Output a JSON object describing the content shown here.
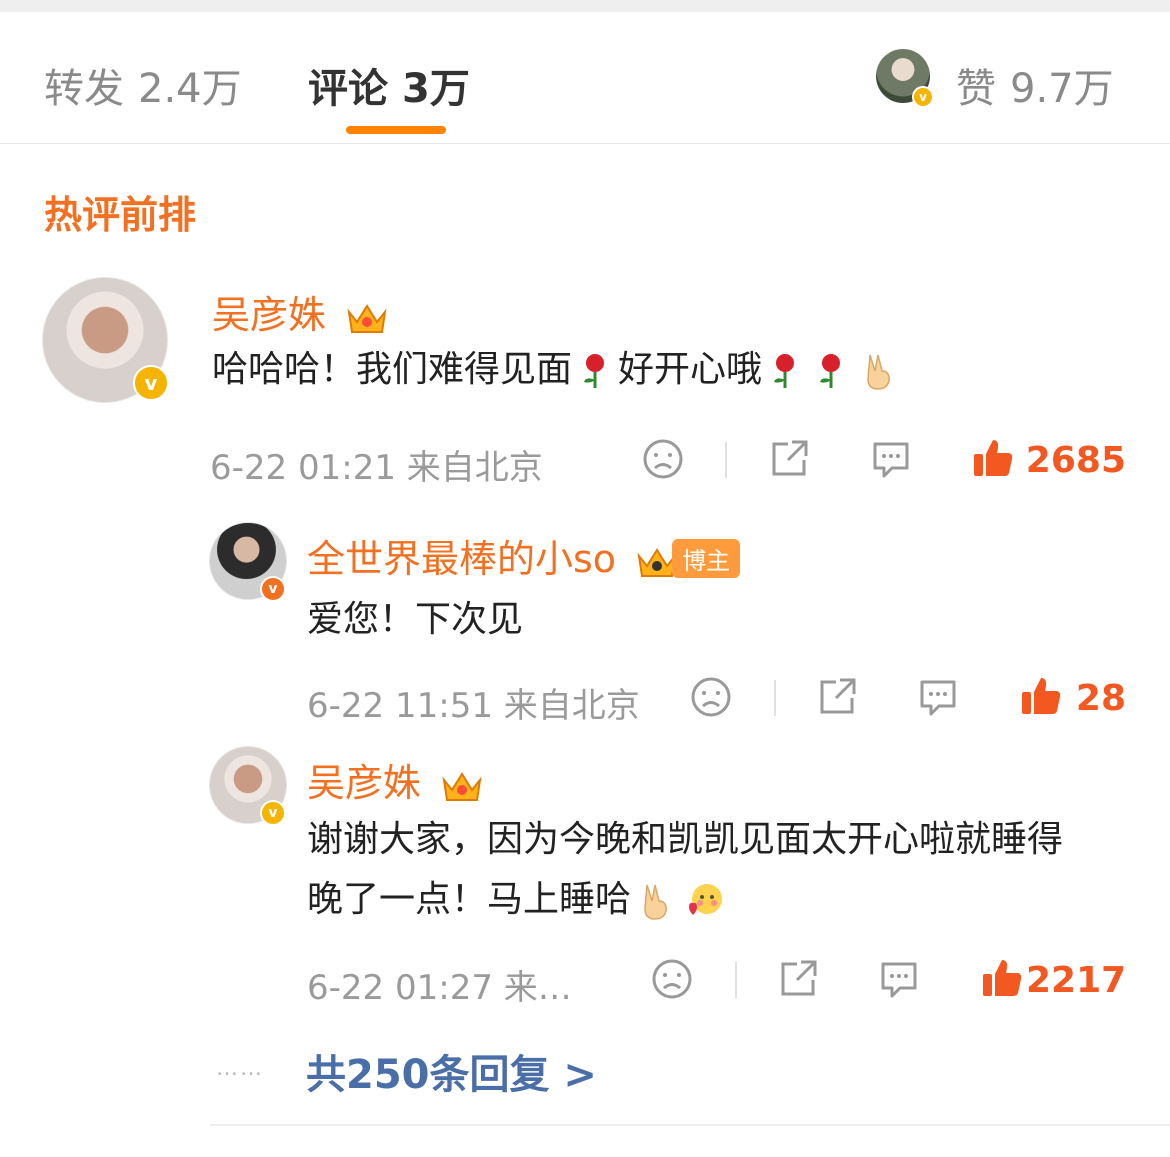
{
  "tabs": {
    "repost_label": "转发",
    "repost_count": "2.4万",
    "comment_label": "评论",
    "comment_count": "3万",
    "like_label": "赞",
    "like_count": "9.7万"
  },
  "section_title": "热评前排",
  "comments": [
    {
      "user": "吴彦姝",
      "text": "哈哈哈！我们难得见面",
      "text_tail": "好开心哦",
      "time": "6-22 01:21",
      "location": "来自北京",
      "likes": "2685"
    },
    {
      "user": "全世界最棒的小so",
      "badge": "博主",
      "text": "爱您！下次见",
      "time": "6-22 11:51",
      "location": "来自北京",
      "likes": "28"
    },
    {
      "user": "吴彦姝",
      "text_line1": "谢谢大家，因为今晚和凯凯见面太开心啦就睡得",
      "text_line2": "晚了一点！马上睡哈",
      "time": "6-22 01:27",
      "location": "来…",
      "likes": "2217"
    }
  ],
  "more_replies": {
    "dots": "……",
    "label": "共250条回复 >"
  },
  "colors": {
    "accent_orange": "#f37021",
    "like_red": "#f35821",
    "link_blue": "#4a6ea8",
    "verified_gold": "#f5b400"
  },
  "icons": [
    "sad-face-icon",
    "share-icon",
    "comment-icon",
    "thumbs-up-icon",
    "crown-icon",
    "verified-icon",
    "rose-icon",
    "victory-hand-icon",
    "blush-emoji-icon"
  ]
}
